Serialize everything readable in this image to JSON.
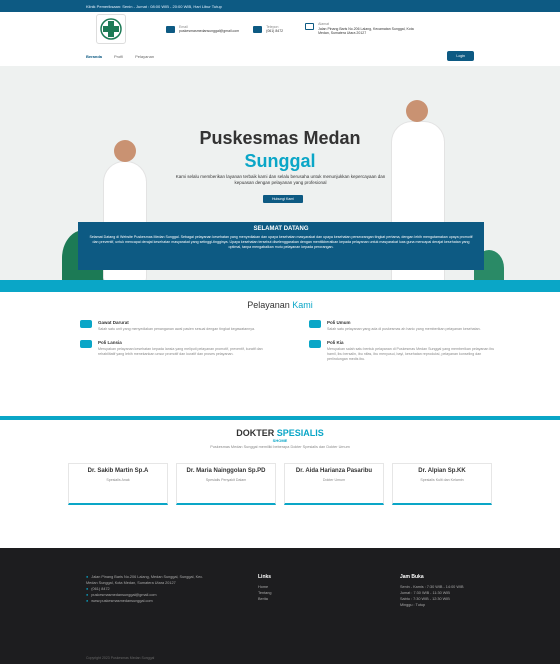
{
  "topbar": {
    "text": "Klinik Pemeriksaan: Senin - Jumat : 08:00 WIB - 20:00 WIB, Hari Libur Tutup"
  },
  "info": {
    "email_label": "Email",
    "email": "puskesmasmedansunggal@gmail.com",
    "phone_label": "Telepon",
    "phone": "(061) 8472",
    "address_label": "Alamat",
    "address": "Jalan Pinang Baris No.206 Lalang, Kecamatan Sunggal, Kota Medan, Sumatera Utara 20127"
  },
  "nav": {
    "home": "Beranda",
    "profile": "Profil",
    "services": "Pelayanan",
    "login": "Login"
  },
  "hero": {
    "title": "Puskesmas Medan",
    "subtitle": "Sunggal",
    "desc": "Kami selalu memberikan layanan terbaik kami dan selalu berusaha untuk menunjukkan kepercayaan dan kepuasan dengan pelayanan yang profesional",
    "button": "Hubungi Kami"
  },
  "welcome": {
    "title": "SELAMAT DATANG",
    "text": "Selamat Datang di Website Puskesmas Medan Sunggal. Sebagai pelayanan kesehatan yang menyediakan dan upaya kesehatan masyarakat dan upaya kesehatan perseorangan tingkat pertama, dengan lebih mengutamakan upaya promotif dan preventif, untuk mencapai derajat kesehatan masyarakat yang setinggi-tingginya. Upaya kesehatan tersebut diselenggarakan dengan menitikberatkan kepada pelayanan untuk masyarakat luas guna mencapai derajat kesehatan yang optimal, tanpa mengabaikan mutu pelayanan kepada perorangan."
  },
  "services": {
    "title": "Pelayanan",
    "title_accent": "Kami",
    "items": [
      {
        "name": "Gawat Darurat",
        "desc": "Salah satu unit yang menyediakan penanganan awal pasien sesuai dengan tingkat kegawatannya."
      },
      {
        "name": "Poli Umum",
        "desc": "Salah satu pelayanan yang ada di puskesmas ah hanic yang memberikan pelayanan kesehatan."
      },
      {
        "name": "Poli Lansia",
        "desc": "Merupakan pelayanan kesehatan kepada lansia yang meliputi pelayanan promotif, preventif, kuratif dan rehabilitatif yang lebih menekankan unsur promotif dan kuratif dan proses pelayanan."
      },
      {
        "name": "Poli Kia",
        "desc": "Merupakan salah satu bentuk pelayanan di Puskesmas Medan Sunggal yang memberikan pelayanan ibu hamil, ibu bersalin, ibu nifas, ibu menyusui, bayi, kesehatan reproduksi, pelayanan konseling dan perlindungan medis ibu."
      }
    ]
  },
  "doctors": {
    "title": "DOKTER",
    "title_accent": "SPESIALIS",
    "tag": "SHOME",
    "desc": "Puskesmas Medan Sunggal memiliki beberapa Dokter Spesialis dan Dokter Umum",
    "items": [
      {
        "name": "Dr. Sakib Martin Sp.A",
        "spec": "Spesialis Anak"
      },
      {
        "name": "Dr. Maria Nainggolan Sp.PD",
        "spec": "Spesialis Penyakit Dalam"
      },
      {
        "name": "Dr. Aida Harianza Pasaribu",
        "spec": "Dokter Umum"
      },
      {
        "name": "Dr. Alpian Sp.KK",
        "spec": "Spesialis Kulit dan Kelamin"
      }
    ]
  },
  "footer": {
    "contact": [
      "Jalan Pinang Baris No.206 Lalang, Medan Sunggal, Sunggal, Kec. Medan Sunggal, Kota Medan, Sumatera Utara 20127",
      "(061) 8472",
      "puskesmasmedansunggal@gmail.com",
      "www.puskesmasmedansunggal.com"
    ],
    "links_title": "Links",
    "links": [
      "Home",
      "Tentang",
      "Berita"
    ],
    "hours_title": "Jam Buka",
    "hours": [
      "Senin - Kamis : 7:30 WIB - 14:00 WIB",
      "Jumat : 7:30 WIB - 11:30 WIB",
      "Sabtu : 7:30 WIB - 12:30 WIB",
      "Minggu : Tutup"
    ],
    "copyright": "Copyright 2023 Puskesmas Medan Sunggal"
  }
}
